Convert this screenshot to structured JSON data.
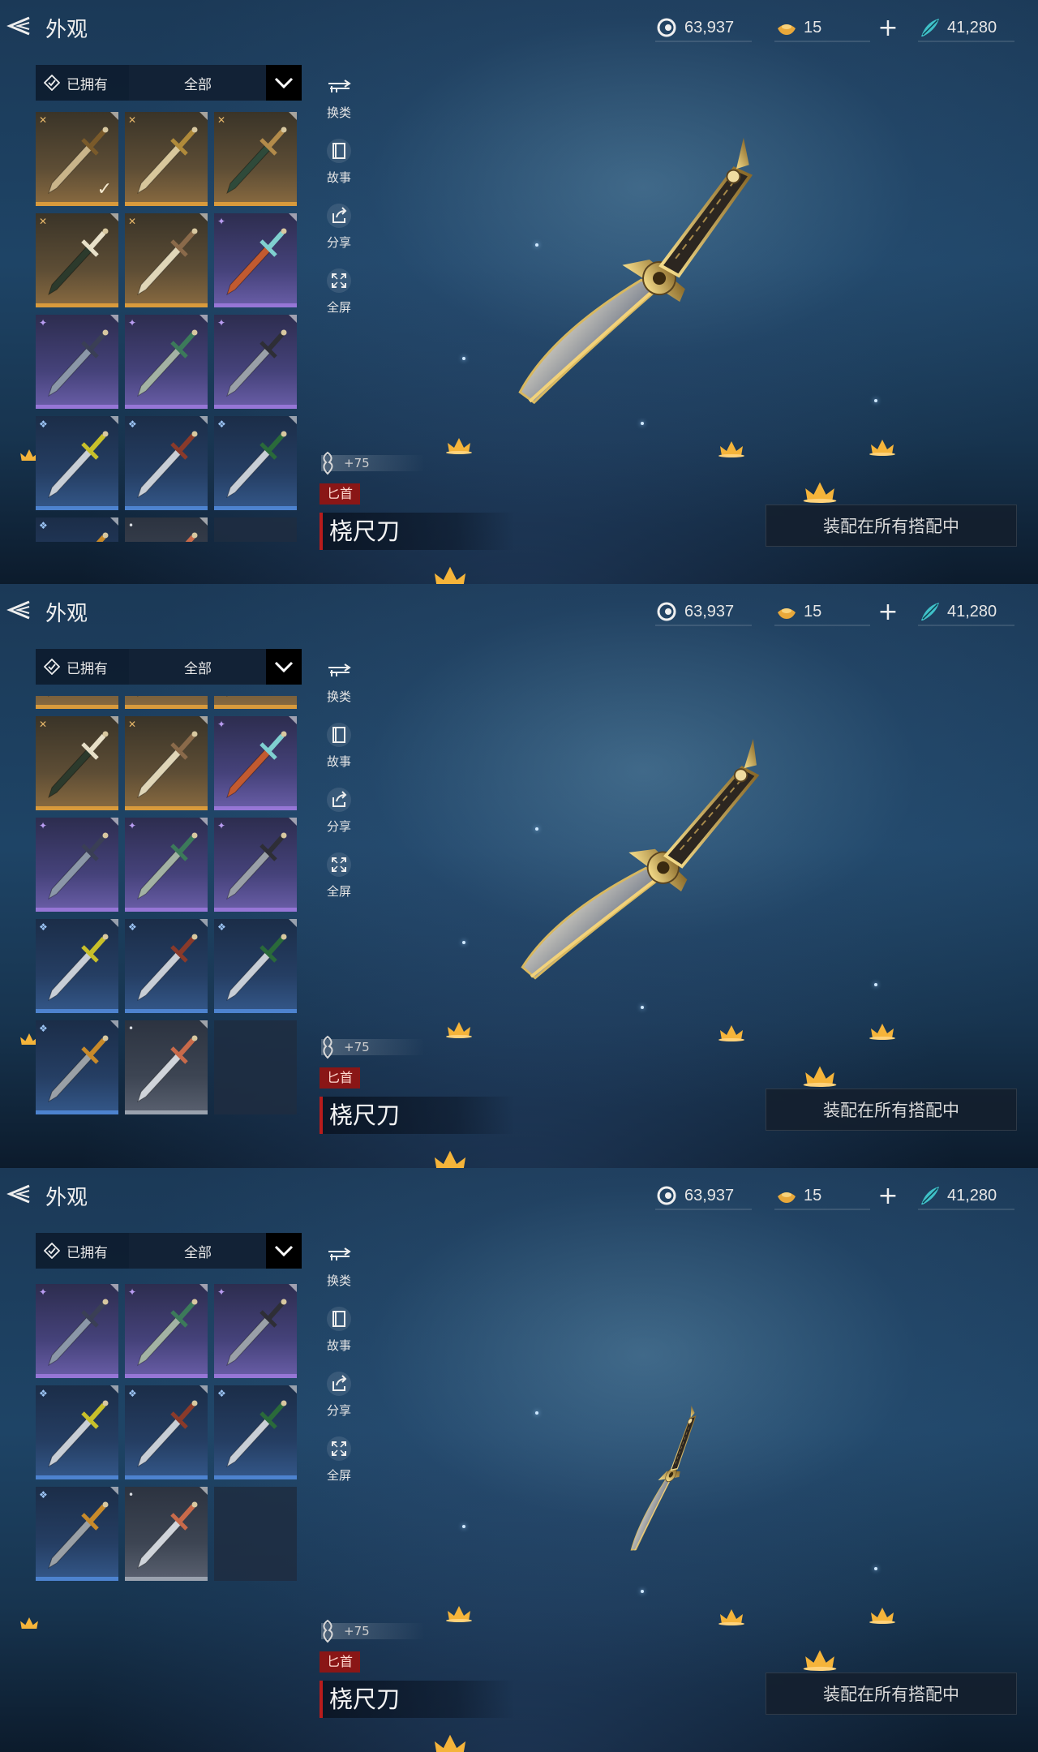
{
  "header": {
    "title": "外观",
    "currency_spirit": "63,937",
    "currency_ingot": "15",
    "currency_jade": "41,280",
    "add_label": "+"
  },
  "filter": {
    "owned_label": "已拥有",
    "category_selected": "全部"
  },
  "tools": [
    {
      "icon": "swap-weapon-icon",
      "label": "换类"
    },
    {
      "icon": "book-icon",
      "label": "故事"
    },
    {
      "icon": "share-icon",
      "label": "分享"
    },
    {
      "icon": "fullscreen-icon",
      "label": "全屏"
    }
  ],
  "item": {
    "level": "+75",
    "type_tag": "匕首",
    "name": "桡尺刀",
    "equip_button": "装配在所有搭配中"
  },
  "panels": [
    {
      "scroll_offset": 0,
      "selected_index": 0
    },
    {
      "scroll_offset": 0.34,
      "selected_index": -1
    },
    {
      "scroll_offset": 0.6,
      "selected_index": -1
    }
  ],
  "grid_items": [
    {
      "rarity": "gold",
      "tier": "✕",
      "weapon_color": "#c9b48a",
      "hilt": "#7a5a2a"
    },
    {
      "rarity": "gold",
      "tier": "✕",
      "weapon_color": "#d8c79c",
      "hilt": "#b08a3a"
    },
    {
      "rarity": "gold",
      "tier": "✕",
      "weapon_color": "#2f4a3a",
      "hilt": "#b38b4a"
    },
    {
      "rarity": "gold",
      "tier": "✕",
      "weapon_color": "#2c3a2c",
      "hilt": "#e8e0c8"
    },
    {
      "rarity": "gold",
      "tier": "✕",
      "weapon_color": "#e0d6b8",
      "hilt": "#8a6a4a"
    },
    {
      "rarity": "purple",
      "tier": "✦",
      "weapon_color": "#c25a30",
      "hilt": "#7fd0d0"
    },
    {
      "rarity": "purple",
      "tier": "✦",
      "weapon_color": "#8b97a8",
      "hilt": "#3a3f55"
    },
    {
      "rarity": "purple",
      "tier": "✦",
      "weapon_color": "#a3b2a4",
      "hilt": "#3c7a5a"
    },
    {
      "rarity": "purple",
      "tier": "✦",
      "weapon_color": "#9aa0a8",
      "hilt": "#2e2e36"
    },
    {
      "rarity": "blue",
      "tier": "❖",
      "weapon_color": "#c8ced6",
      "hilt": "#c8c02a"
    },
    {
      "rarity": "blue",
      "tier": "❖",
      "weapon_color": "#c8ced6",
      "hilt": "#8a3a2a"
    },
    {
      "rarity": "blue",
      "tier": "❖",
      "weapon_color": "#c8ced6",
      "hilt": "#2a6a3a"
    },
    {
      "rarity": "blue",
      "tier": "❖",
      "weapon_color": "#9aa0a6",
      "hilt": "#c88a2a"
    },
    {
      "rarity": "gray",
      "tier": "•",
      "weapon_color": "#d0d4da",
      "hilt": "#c86a4a"
    },
    {
      "rarity": "empty",
      "tier": "",
      "weapon_color": "",
      "hilt": ""
    }
  ],
  "colors": {
    "gold_rarity": "#d89a3c",
    "purple_rarity": "#9676d6",
    "blue_rarity": "#4d83cf",
    "type_tag_bg": "#8a1616",
    "name_accent": "#b81c1c"
  }
}
